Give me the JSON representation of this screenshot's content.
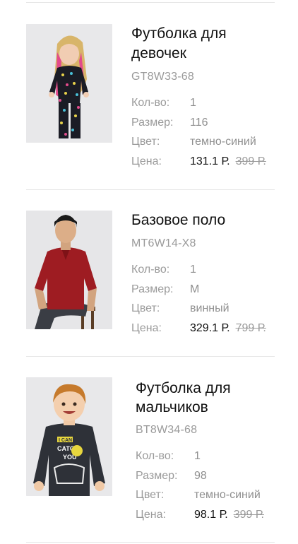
{
  "labels": {
    "qty": "Кол-во:",
    "size": "Размер:",
    "color": "Цвет:",
    "price": "Цена:"
  },
  "items": [
    {
      "title_line1": "Футболка для",
      "title_line2": "девочек",
      "sku": "GT8W33-68",
      "qty": "1",
      "size": "116",
      "color": "темно-синий",
      "price": "131.1 Р.",
      "old_price": "399 Р.",
      "image": "girl-in-dark-star-print-outfit"
    },
    {
      "title_line1": "Базовое поло",
      "title_line2": "",
      "sku": "MT6W14-X8",
      "qty": "1",
      "size": "M",
      "color": "винный",
      "price": "329.1 Р.",
      "old_price": "799 Р.",
      "image": "man-in-burgundy-polo-seated"
    },
    {
      "title_line1": "Футболка для",
      "title_line2": "мальчиков",
      "sku": "BT8W34-68",
      "qty": "1",
      "size": "98",
      "color": "темно-синий",
      "price": "98.1 Р.",
      "old_price": "399 Р.",
      "image": "boy-in-dark-printed-long-sleeve",
      "print_text": [
        "I CAN",
        "CATCH",
        "YOU"
      ]
    }
  ]
}
